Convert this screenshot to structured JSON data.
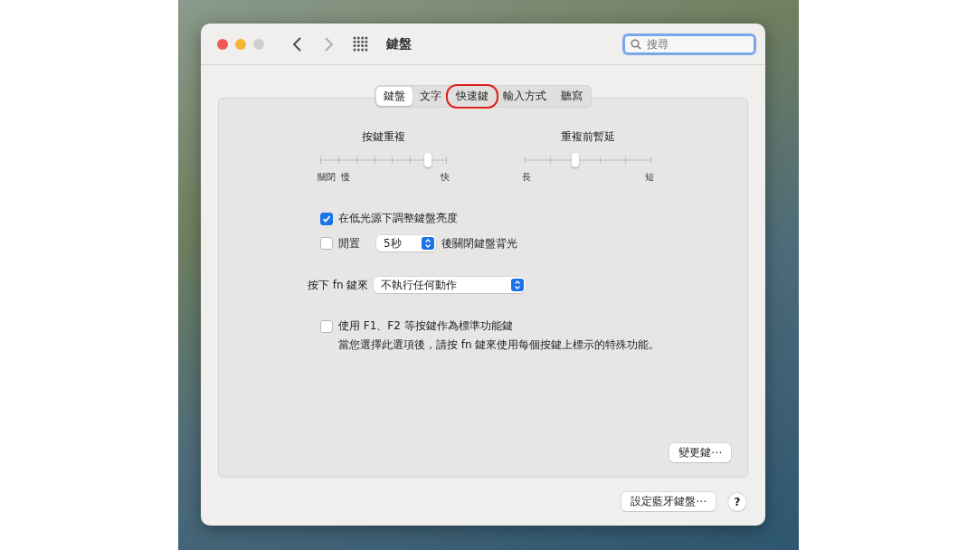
{
  "window": {
    "title": "鍵盤",
    "search": {
      "placeholder": "搜尋"
    }
  },
  "tabs": [
    {
      "label": "鍵盤",
      "selected": true,
      "circled": false
    },
    {
      "label": "文字",
      "selected": false,
      "circled": false
    },
    {
      "label": "快速鍵",
      "selected": false,
      "circled": true
    },
    {
      "label": "輸入方式",
      "selected": false,
      "circled": false
    },
    {
      "label": "聽寫",
      "selected": false,
      "circled": false
    }
  ],
  "sliders": [
    {
      "title": "按鍵重複",
      "level": 0.857,
      "left_labels": [
        "關閉",
        "慢"
      ],
      "right_label": "快"
    },
    {
      "title": "重複前暫延",
      "level": 0.4,
      "left_labels": [
        "長"
      ],
      "right_label": "短"
    }
  ],
  "options": [
    {
      "kind": "checkbox",
      "checked": true,
      "label": "在低光源下調整鍵盤亮度"
    },
    {
      "kind": "checkbox-popup",
      "checked": false,
      "label": "閒置",
      "popup": "5秒",
      "after": "後關閉鍵盤背光"
    },
    {
      "kind": "popup",
      "label": "按下 fn 鍵來",
      "popup": "不執行任何動作"
    },
    {
      "kind": "checkbox",
      "checked": false,
      "label": "使用 F1、F2 等按鍵作為標準功能鍵",
      "note": "當您選擇此選項後，請按 fn 鍵來使用每個按鍵上標示的特殊功能。"
    }
  ],
  "modifier_button": "變更鍵⋯",
  "bluetooth_button": "設定藍牙鍵盤⋯",
  "help_button": "?"
}
